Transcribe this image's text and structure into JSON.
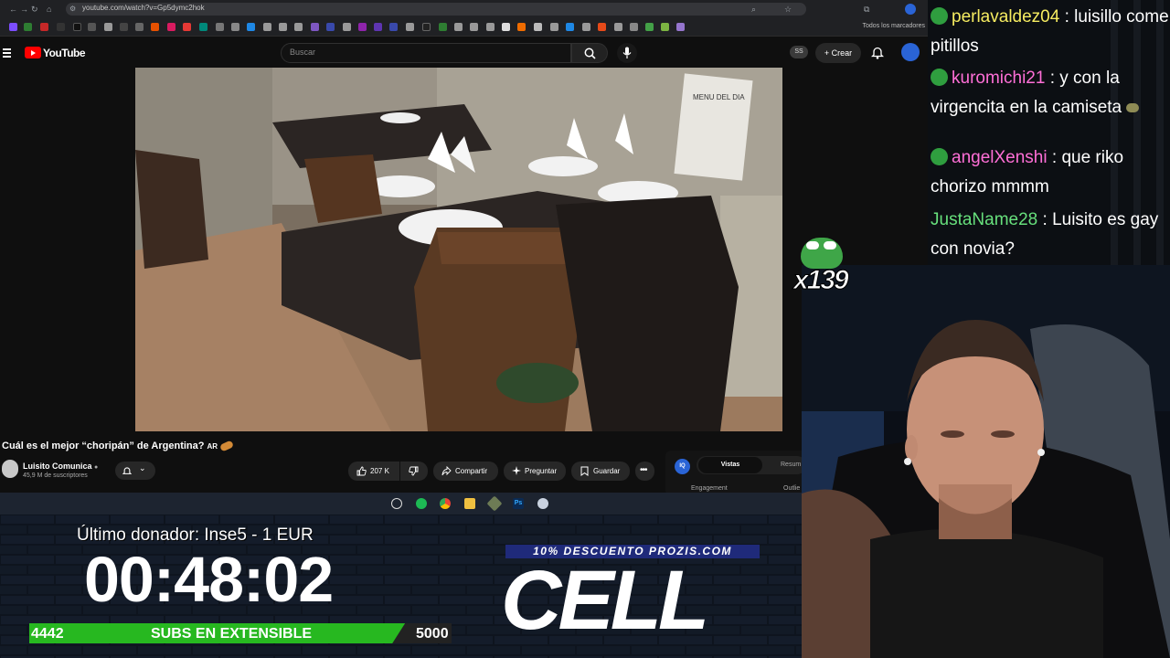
{
  "browser": {
    "url": "youtube.com/watch?v=Gp5dymc2hok",
    "bookmarks_folder": "Todos los marcadores"
  },
  "youtube": {
    "logo_text": "YouTube",
    "search_placeholder": "Buscar",
    "ss_badge": "SS",
    "create_label": "Crear",
    "video_title": "Cuál es el mejor “choripán” de Argentina?",
    "title_flag": "AR",
    "channel_name": "Luisito Comunica",
    "channel_subs": "45,9 M de suscriptores",
    "likes": "207 K",
    "share_label": "Compartir",
    "ask_label": "Preguntar",
    "save_label": "Guardar",
    "panel": {
      "badge": "IQ",
      "tab_vistas": "Vistas",
      "tab_resumen": "Resum",
      "engagement": "Engagement",
      "outlier": "Outlie"
    }
  },
  "overlay": {
    "last_donor": "Último donador: Inse5 - 1 EUR",
    "timer": "00:48:02",
    "subs_label": "SUBS EN EXTENSIBLE",
    "subs_min": "4442",
    "subs_max": "5000",
    "subs_progress_fraction": 0.89,
    "promo": "10% DESCUENTO PROZIS.COM",
    "sponsor": "CELL"
  },
  "chat": {
    "messages": [
      {
        "user": "perlavaldez04",
        "color": "#f6ec61",
        "text": "luisillo come pitillos"
      },
      {
        "user": "kuromichi21",
        "color": "#ff6fd7",
        "text": "y con la virgencita en la camiseta"
      },
      {
        "user": "angelXenshi",
        "color": "#ff6fd7",
        "text": "que riko chorizo mmmm"
      },
      {
        "user": "JustaName28",
        "color": "#67e07c",
        "text": "Luisito es gay con novia?"
      }
    ]
  },
  "emote_combo": {
    "emote": "pepe-frog-icon",
    "count_text": "x139"
  }
}
